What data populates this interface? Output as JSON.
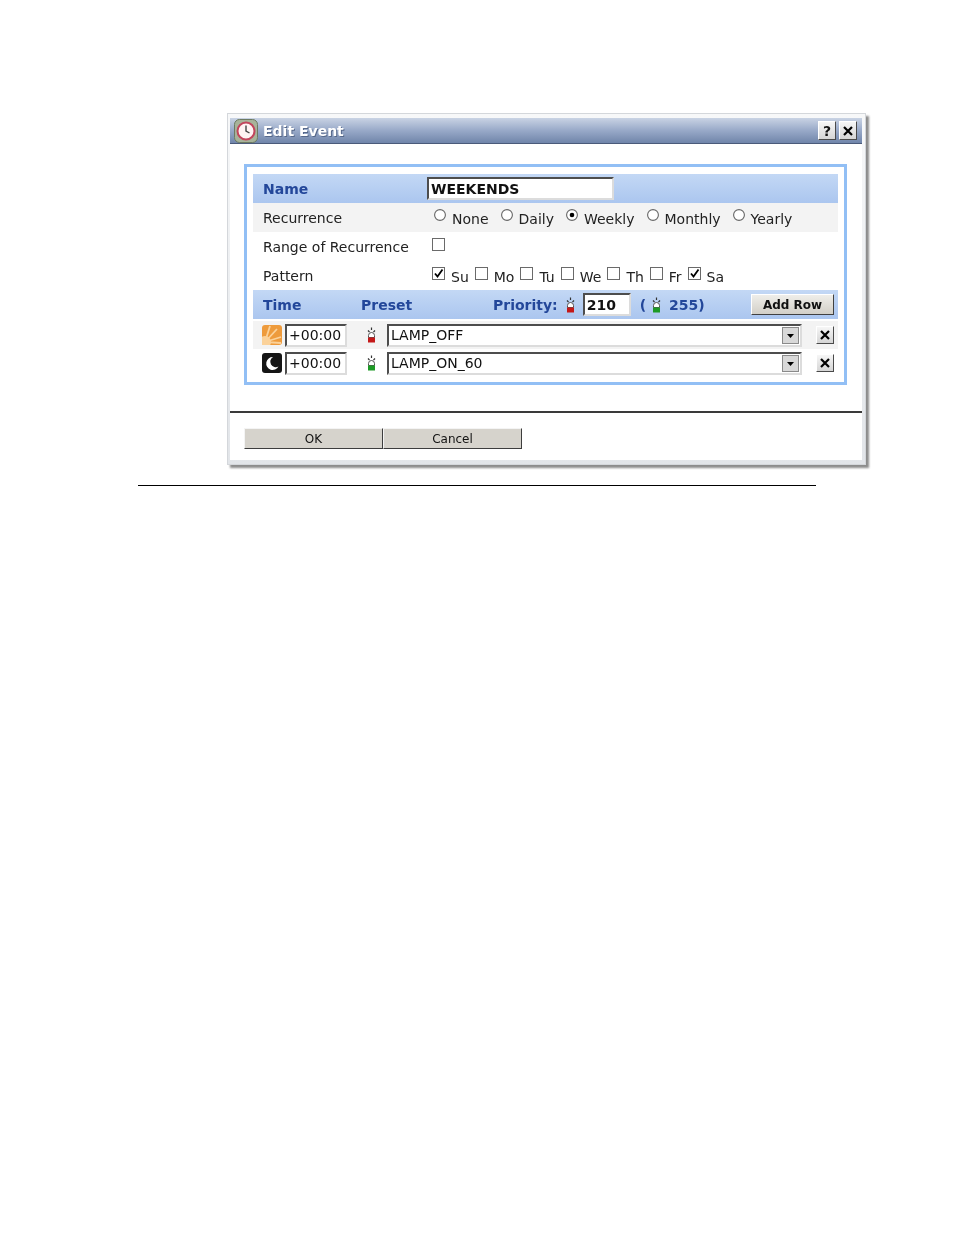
{
  "window": {
    "title": "Edit Event",
    "help": "?"
  },
  "form": {
    "name": {
      "label": "Name",
      "value": "WEEKENDS"
    },
    "recurrence": {
      "label": "Recurrence",
      "options": [
        {
          "label": "None",
          "selected": false
        },
        {
          "label": "Daily",
          "selected": false
        },
        {
          "label": "Weekly",
          "selected": true
        },
        {
          "label": "Monthly",
          "selected": false
        },
        {
          "label": "Yearly",
          "selected": false
        }
      ]
    },
    "range": {
      "label": "Range of Recurrence",
      "checked": false
    },
    "pattern": {
      "label": "Pattern",
      "days": [
        {
          "label": "Su",
          "checked": true
        },
        {
          "label": "Mo",
          "checked": false
        },
        {
          "label": "Tu",
          "checked": false
        },
        {
          "label": "We",
          "checked": false
        },
        {
          "label": "Th",
          "checked": false
        },
        {
          "label": "Fr",
          "checked": false
        },
        {
          "label": "Sa",
          "checked": true
        }
      ]
    }
  },
  "events": {
    "columns": [
      "Time",
      "Preset"
    ],
    "priority": {
      "label": "Priority:",
      "value": "210",
      "lamp_on": false
    },
    "priority_max": {
      "open": "(",
      "value": "255)",
      "lamp_on": true
    },
    "add_button": "Add Row",
    "rows": [
      {
        "kind": "sun",
        "time": "+00:00",
        "lamp_on": false,
        "preset": "LAMP_OFF"
      },
      {
        "kind": "moon",
        "time": "+00:00",
        "lamp_on": true,
        "preset": "LAMP_ON_60"
      }
    ]
  },
  "buttons": [
    "OK",
    "Cancel"
  ]
}
